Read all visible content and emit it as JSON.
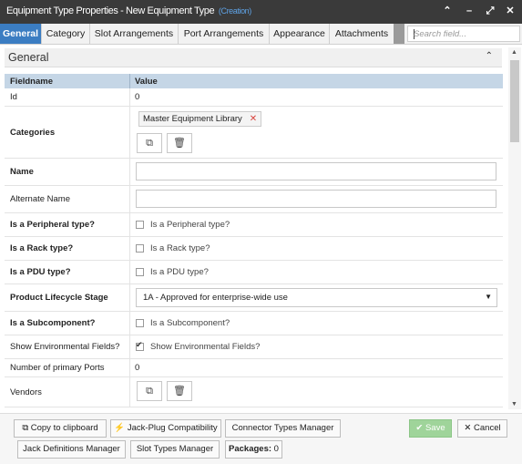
{
  "window": {
    "title": "Equipment Type Properties - New Equipment Type",
    "mode": "(Creation)",
    "controls": [
      "chevron-up-icon",
      "minimize-icon",
      "maximize-icon",
      "close-icon"
    ]
  },
  "tabs": [
    "General",
    "Category",
    "Slot Arrangements",
    "Port Arrangements",
    "Appearance",
    "Attachments"
  ],
  "search": {
    "placeholder": "Search field..."
  },
  "section": {
    "title": "General"
  },
  "grid": {
    "headers": {
      "fieldname": "Fieldname",
      "value": "Value"
    },
    "rows": {
      "id": {
        "label": "Id",
        "value": "0"
      },
      "categories": {
        "label": "Categories",
        "tag": "Master Equipment Library"
      },
      "name": {
        "label": "Name",
        "value": ""
      },
      "alternate_name": {
        "label": "Alternate Name",
        "value": ""
      },
      "peripheral": {
        "label": "Is a Peripheral type?",
        "option": "Is a Peripheral type?",
        "checked": false
      },
      "rack": {
        "label": "Is a Rack type?",
        "option": "Is a Rack type?",
        "checked": false
      },
      "pdu": {
        "label": "Is a PDU type?",
        "option": "Is a PDU type?",
        "checked": false
      },
      "lifecycle": {
        "label": "Product Lifecycle Stage",
        "value": "1A - Approved for enterprise-wide use"
      },
      "subcomponent": {
        "label": "Is a Subcomponent?",
        "option": "Is a Subcomponent?",
        "checked": false
      },
      "environmental": {
        "label": "Show Environmental Fields?",
        "option": "Show Environmental Fields?",
        "checked": true
      },
      "primary_ports": {
        "label": "Number of primary Ports",
        "value": "0"
      },
      "vendors": {
        "label": "Vendors"
      }
    }
  },
  "footer": {
    "copy": "Copy to clipboard",
    "jack_plug": "Jack-Plug Compatibility",
    "connector_types": "Connector Types Manager",
    "save": "Save",
    "cancel": "Cancel",
    "jack_definitions": "Jack Definitions Manager",
    "slot_types": "Slot Types Manager",
    "packages_label": "Packages:",
    "packages_count": "0"
  }
}
